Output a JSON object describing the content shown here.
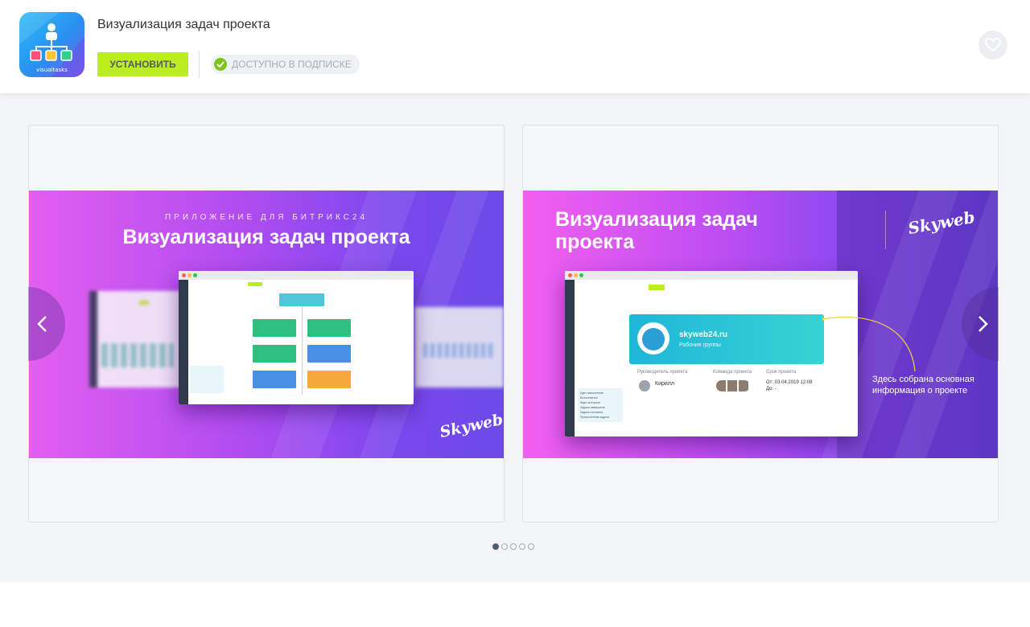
{
  "app": {
    "icon_caption": "visualtasks",
    "title": "Визуализация задач проекта",
    "install_label": "УСТАНОВИТЬ",
    "subscription_label": "ДОСТУПНО В ПОДПИСКЕ"
  },
  "slides": [
    {
      "subtitle": "ПРИЛОЖЕНИЕ ДЛЯ БИТРИКС24",
      "title": "Визуализация задач проекта",
      "brand": "Skyweb"
    },
    {
      "title": "Визуализация задач проекта",
      "brand": "Skyweb",
      "project_name": "skyweb24.ru",
      "project_sub": "Рабочие группы",
      "col_manager": "Руководитель проекта",
      "col_team": "Команда проекта",
      "col_deadline": "Срок проекта",
      "manager_name": "Кирилл",
      "deadline_from": "От: 03.04.2019 12:08",
      "deadline_to": "До: -",
      "callout": "Здесь собрана основная информация о проекте",
      "legend": [
        "Идет выполнение",
        "Выполняется",
        "Ждет контроля",
        "Задача завершена",
        "Задача отложена",
        "Просроченная задача"
      ]
    }
  ],
  "slider": {
    "total": 5,
    "active": 1
  },
  "colors": {
    "install_button": "#bbed21",
    "check": "#7fc318",
    "dot_active": "#535c69"
  }
}
